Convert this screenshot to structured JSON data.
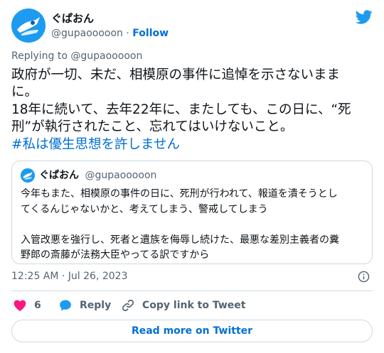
{
  "author": {
    "name": "ぐぱおん",
    "handle": "@gupaooooon",
    "follow_label": "Follow",
    "separator": "·"
  },
  "reply_to": {
    "prefix": "Replying to ",
    "handle": "@gupaooooon"
  },
  "tweet": {
    "lines": [
      "政府が一切、未だ、相模原の事件に追悼を示さないまま",
      "に。",
      "18年に続いて、去年22年に、またしても、この日に、“死",
      "刑”が執行されたこと、忘れてはいけないこと。"
    ],
    "hashtag": "#私は優生思想を許しません"
  },
  "quote": {
    "name": "ぐぱおん",
    "handle": "@gupaooooon",
    "lines": [
      "今年もまた、相模原の事件の日に、死刑が行われて、報道を潰そうとし",
      "てくるんじゃないかと、考えてしまう、警戒してしまう",
      "",
      "入管改悪を強行し、死者と遺族を侮辱し続けた、最悪な差別主義者の糞",
      "野郎の斎藤が法務大臣やってる訳ですから"
    ]
  },
  "timestamp": "12:25 AM · Jul 26, 2023",
  "actions": {
    "like_count": "6",
    "reply_label": "Reply",
    "copy_label": "Copy link to Tweet"
  },
  "read_more_label": "Read more on Twitter",
  "colors": {
    "text": "#0f1419",
    "secondary": "#536471",
    "link": "#006fd6",
    "twitter_blue": "#1d9bf0",
    "like_red": "#f91880",
    "border": "#cfd9de"
  },
  "icons": [
    "twitter-bird-icon",
    "info-icon",
    "heart-icon",
    "reply-bubble-icon",
    "link-icon"
  ]
}
